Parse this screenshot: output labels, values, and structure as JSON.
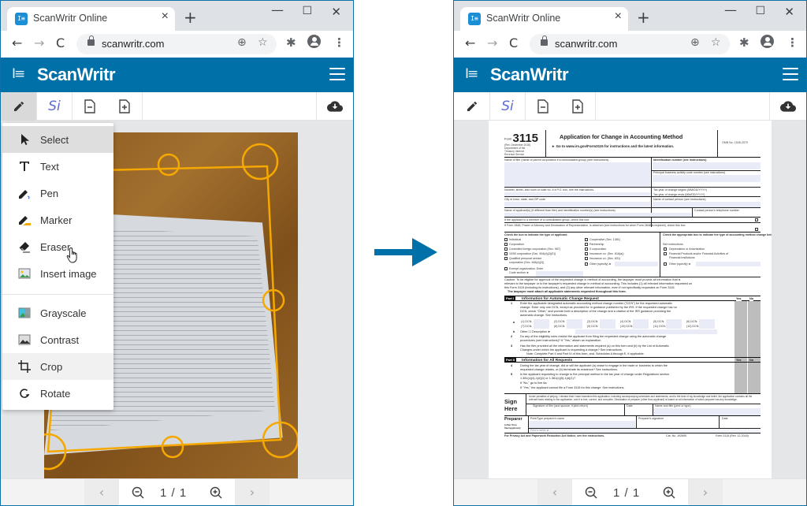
{
  "browser": {
    "tab_title": "ScanWritr Online",
    "tab_favicon": "I≡",
    "tab_close": "×",
    "new_tab": "+",
    "window_controls": {
      "minimize": "—",
      "maximize": "☐",
      "close": "✕"
    },
    "nav": {
      "back": "←",
      "forward": "→",
      "reload": "C"
    },
    "url": "scanwritr.com",
    "omnibox_icons": {
      "add": "⊕",
      "star": "☆"
    },
    "extensions": {
      "puzzle": "✱",
      "more": "⋮"
    }
  },
  "app": {
    "logo_icon": "I≡",
    "name": "ScanWritr",
    "accent_color": "#0070a8",
    "toolbar": {
      "pen": "pen-icon",
      "sign_label": "Si",
      "remove_page": "remove-page-icon",
      "add_page": "add-page-icon",
      "upload": "cloud-upload-icon"
    },
    "pager": {
      "prev": "‹",
      "next": "›",
      "indicator": "1 / 1"
    }
  },
  "left_panel": {
    "menu": {
      "items": [
        {
          "label": "Select",
          "icon": "cursor-icon",
          "state": "active"
        },
        {
          "label": "Text",
          "icon": "text-icon"
        },
        {
          "label": "Pen",
          "icon": "pen-icon"
        },
        {
          "label": "Marker",
          "icon": "marker-icon"
        },
        {
          "label": "Eraser",
          "icon": "eraser-icon"
        },
        {
          "label": "Insert image",
          "icon": "image-icon"
        }
      ],
      "image_items": [
        {
          "label": "Grayscale",
          "icon": "grayscale-icon"
        },
        {
          "label": "Contrast",
          "icon": "contrast-icon"
        },
        {
          "label": "Crop",
          "icon": "crop-icon",
          "state": "hover"
        },
        {
          "label": "Rotate",
          "icon": "rotate-icon"
        }
      ]
    },
    "photo": {
      "description": "Photo of paper form on wooden table with crop handles",
      "crop_color": "#f5a800"
    }
  },
  "arrow_color": "#0070a8",
  "right_panel": {
    "document": {
      "form_label": "Form",
      "form_number": "3115",
      "form_rev": "(Rev. December 2018)",
      "form_dept": "Department of the Treasury Internal Revenue Service",
      "title": "Application for Change in Accounting Method",
      "goto": "► Go to www.irs.gov/Form3115 for instructions and the latest information.",
      "omb": "OMB No. 1545-2070",
      "fields": {
        "filer_name": "Name of filer (name of parent corporation if a consolidated group) (see instructions)",
        "id_number": "Identification number (see instructions)",
        "principal_code": "Principal business activity code number (see instructions)",
        "address": "Number, street, and room or suite no. If a P.O. box, see the instructions.",
        "tax_year_begins": "Tax year of change begins (MM/DD/YYYY)",
        "tax_year_ends": "Tax year of change ends (MM/DD/YYYY)",
        "city": "City or town, state, and ZIP code",
        "contact_name": "Name of contact person (see instructions)",
        "applicant_name": "Name of applicant(s) (if different than filer) and identification number(s) (see instructions)",
        "contact_phone": "Contact person's telephone number"
      },
      "consolidated": "If the applicant is a member of a consolidated group, check this box",
      "form2848": "If Form 2848, Power of Attorney and Declaration of Representative, is attached (see instructions for when Form 2848 is required), check this box",
      "applicant_type_heading": "Check the box to indicate the type of applicant.",
      "applicant_types_col1": [
        "Individual",
        "Corporation",
        "Controlled foreign corporation (Sec. 957)",
        "10/50 corporation (Sec. 904(d)(2)(E))",
        "Qualified personal service",
        "corporation (Sec. 448(d)(2))",
        "Exempt organization. Enter",
        "Code section ►"
      ],
      "applicant_types_col2": [
        "Cooperative (Sec. 1381)",
        "Partnership",
        "S corporation",
        "Insurance co. (Sec. 816(a))",
        "Insurance co. (Sec. 831)",
        "Other (specify) ►"
      ],
      "method_heading": "Check the appropriate box to indicate the type of accounting method change being requested.",
      "method_see": "See instructions.",
      "method_types": [
        "Depreciation or Amortization",
        "Financial Products and/or Financial Activities of",
        "Financial Institutions",
        "Other (specify) ►"
      ],
      "caution": [
        "Caution: To be eligible for approval of the requested change in method of accounting, the taxpayer must provide all information that is",
        "relevant to the taxpayer or to the taxpayer's requested change in method of accounting. This includes (1) all relevant information requested on",
        "this Form 3115 (including its instructions), and (2) any other relevant information, even if not specifically requested on Form 3115.",
        "The taxpayer must attach all applicable statements requested throughout this form."
      ],
      "part1": {
        "tag": "Part I",
        "title": "Information for Automatic Change Request",
        "yes": "Yes",
        "no": "No",
        "line1": [
          "Enter the applicable designated automatic accounting method change number (\"DCN\") for the requested automatic",
          "change. Enter only one DCN, except as provided for in guidance published by the IRS. If the requested change has no",
          "DCN, check \"Other,\" and provide both a description of the change and a citation of the IRS guidance providing the",
          "automatic change. See instructions."
        ],
        "dcn_labels": [
          "(1) DCN:",
          "(2) DCN:",
          "(3) DCN:",
          "(4) DCN:",
          "(5) DCN:",
          "(6) DCN:",
          "(7) DCN:",
          "(8) DCN:",
          "(9) DCN:",
          "(10) DCN:",
          "(11) DCN:",
          "(12) DCN:"
        ],
        "line1b": "Other  ☐  Description ►",
        "line2": [
          "Do any of the eligibility rules restrict the applicant from filing the requested change using the automatic change",
          "procedures (see instructions)? If \"Yes,\" attach an explanation."
        ],
        "line3": [
          "Has the filer provided all the information and statements required (a) on this form and (b) by the List of Automatic",
          "Changes under which the applicant is requesting a change? See instructions.",
          "Note: Complete Part II and Part IV of this form, and, Schedules A through E, if applicable."
        ]
      },
      "part2": {
        "tag": "Part II",
        "title": "Information for All Requests",
        "yes": "Yes",
        "no": "No",
        "line4": [
          "During the tax year of change, did or will the applicant (a) cease to engage in the trade or business to which the",
          "requested change relates, or (b) terminate its existence? See instructions."
        ],
        "line5": [
          "Is the applicant requesting to change to the principal method in the tax year of change under Regulations section",
          "1.381(c)(4)-1(d)(1) or 1.381(c)(5)-1(d)(1)?",
          "If \"No,\" go to line 6a.",
          "If \"Yes,\" the applicant cannot file a Form 3115 for this change. See instructions."
        ]
      },
      "sign": {
        "label": "Sign Here",
        "declaration": "Under penalties of perjury, I declare that I have examined this application, including accompanying schedules and statements, and to the best of my knowledge and belief, the application contains all the relevant facts relating to the application, and it is true, correct, and complete. Declaration of preparer (other than applicant) is based on all information of which preparer has any knowledge.",
        "signature": "Signature of filer (and spouse, if joint return)",
        "date": "Date",
        "name_title": "Name and title (print or type)"
      },
      "preparer": {
        "label": "Preparer",
        "sub": "(other than filer/applicant)",
        "name": "Print/Type preparer's name",
        "signature": "Preparer's signature",
        "date": "Date",
        "firm": "Firm's name ►"
      },
      "footer": {
        "privacy": "For Privacy Act and Paperwork Reduction Act Notice, see the instructions.",
        "cat": "Cat. No. 19280E",
        "form": "Form 3115 (Rev. 12-2018)"
      }
    }
  }
}
